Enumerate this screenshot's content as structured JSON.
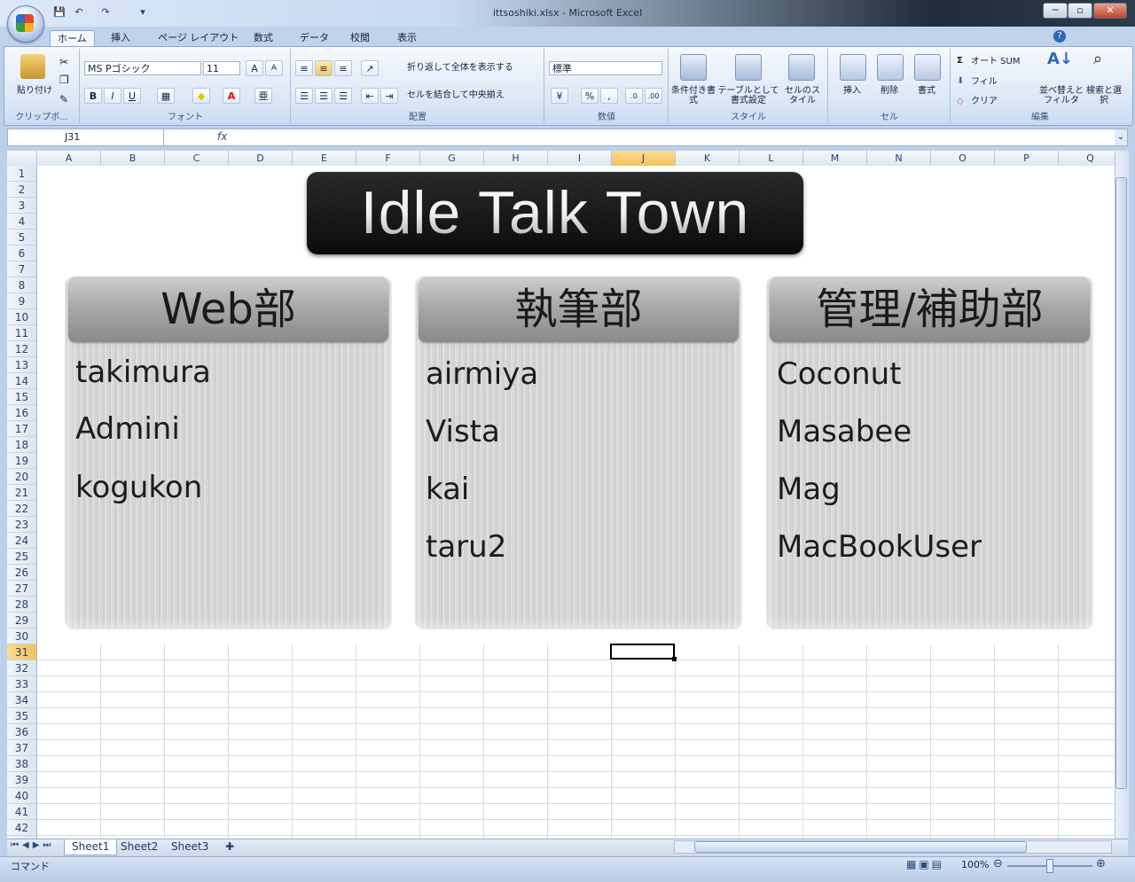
{
  "window": {
    "title": "ittsoshiki.xlsx - Microsoft Excel",
    "min": "─",
    "max": "▫",
    "close": "✕"
  },
  "qat": {
    "save": "💾",
    "undo": "↶",
    "redo": "↷",
    "customize": "▾"
  },
  "ribbon_tabs": [
    "ホーム",
    "挿入",
    "ページ レイアウト",
    "数式",
    "データ",
    "校閲",
    "表示"
  ],
  "ribbon": {
    "clipboard": {
      "label": "クリップボ...",
      "paste": "貼り付け"
    },
    "font": {
      "label": "フォント",
      "name": "MS Pゴシック",
      "size": "11",
      "bold": "B",
      "italic": "I",
      "underline": "U",
      "grow": "A",
      "shrink": "A"
    },
    "alignment": {
      "label": "配置",
      "wrap": "折り返して全体を表示する",
      "merge": "セルを結合して中央揃え"
    },
    "number": {
      "label": "数値",
      "format": "標準",
      "percent": "%",
      "comma": ","
    },
    "styles": {
      "label": "スタイル",
      "conditional": "条件付き書式",
      "table": "テーブルとして書式設定",
      "cell": "セルのスタイル"
    },
    "cells": {
      "label": "セル",
      "insert": "挿入",
      "delete": "削除",
      "format": "書式"
    },
    "editing": {
      "label": "編集",
      "autosum": "オート SUM",
      "fill": "フィル",
      "clear": "クリア",
      "sort": "並べ替えとフィルタ",
      "find": "検索と選択"
    }
  },
  "formula_bar": {
    "name_box": "J31",
    "fx": "fx",
    "value": ""
  },
  "columns": [
    "A",
    "B",
    "C",
    "D",
    "E",
    "F",
    "G",
    "H",
    "I",
    "J",
    "K",
    "L",
    "M",
    "N",
    "O",
    "P",
    "Q"
  ],
  "selected_column": "J",
  "rows": [
    "1",
    "2",
    "3",
    "4",
    "5",
    "6",
    "7",
    "8",
    "9",
    "10",
    "11",
    "12",
    "13",
    "14",
    "15",
    "16",
    "17",
    "18",
    "19",
    "20",
    "21",
    "22",
    "23",
    "24",
    "25",
    "26",
    "27",
    "28",
    "29",
    "30",
    "31",
    "32",
    "33",
    "34",
    "35",
    "36",
    "37",
    "38",
    "39",
    "40",
    "41",
    "42"
  ],
  "selected_row": "31",
  "banner": {
    "title": "Idle Talk Town"
  },
  "panels": [
    {
      "heading": "Web部",
      "members": [
        "takimura",
        "Admini",
        "kogukon"
      ]
    },
    {
      "heading": "執筆部",
      "members": [
        "airmiya",
        "Vista",
        "kai",
        "taru2"
      ]
    },
    {
      "heading": "管理/補助部",
      "members": [
        "Coconut",
        "Masabee",
        "Mag",
        "MacBookUser"
      ]
    }
  ],
  "sheet_tabs": [
    "Sheet1",
    "Sheet2",
    "Sheet3"
  ],
  "active_sheet": "Sheet1",
  "status": {
    "mode": "コマンド",
    "zoom": "100%"
  },
  "colors": {
    "banner_bg": "#111111",
    "header_bg": "#9c9c9c",
    "selection": "#f3c15a"
  }
}
